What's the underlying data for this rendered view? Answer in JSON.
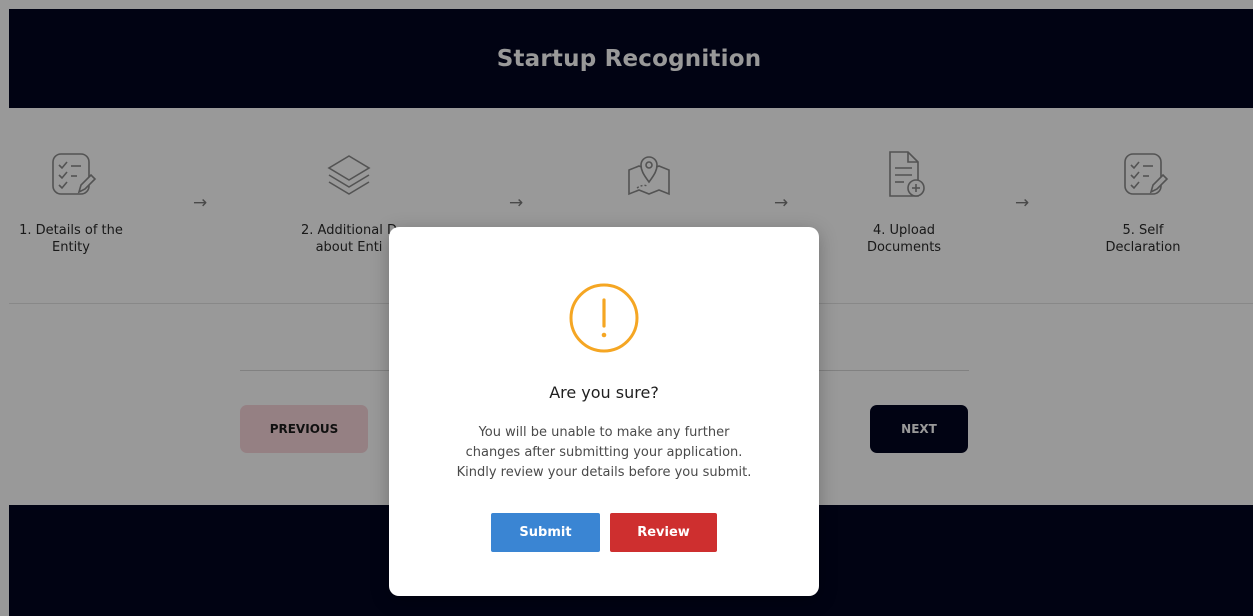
{
  "header": {
    "title": "Startup Recognition"
  },
  "steps": [
    {
      "label_line1": "1. Details of the",
      "label_line2": "Entity",
      "icon": "checklist-edit-icon"
    },
    {
      "label_line1": "2. Additional D",
      "label_line2": "about Enti",
      "icon": "layers-icon"
    },
    {
      "label_line1": "",
      "label_line2": "",
      "icon": "map-location-icon"
    },
    {
      "label_line1": "4. Upload",
      "label_line2": "Documents",
      "icon": "document-add-icon"
    },
    {
      "label_line1": "5. Self",
      "label_line2": "Declaration",
      "icon": "checklist-edit-icon"
    }
  ],
  "arrows": [
    "→",
    "→",
    "→",
    "→"
  ],
  "nav": {
    "previous_label": "PREVIOUS",
    "next_label": "NEXT"
  },
  "modal": {
    "icon": "warning-icon",
    "title": "Are you sure?",
    "lines": [
      "You will be unable to make any further",
      "changes after submitting your application.",
      "Kindly review your details before you submit."
    ],
    "submit_label": "Submit",
    "review_label": "Review"
  },
  "colors": {
    "navy": "#020520",
    "warning": "#f5a623",
    "submit": "#3a85d3",
    "review": "#ce2f2f",
    "previous_bg": "#f8d5da"
  }
}
